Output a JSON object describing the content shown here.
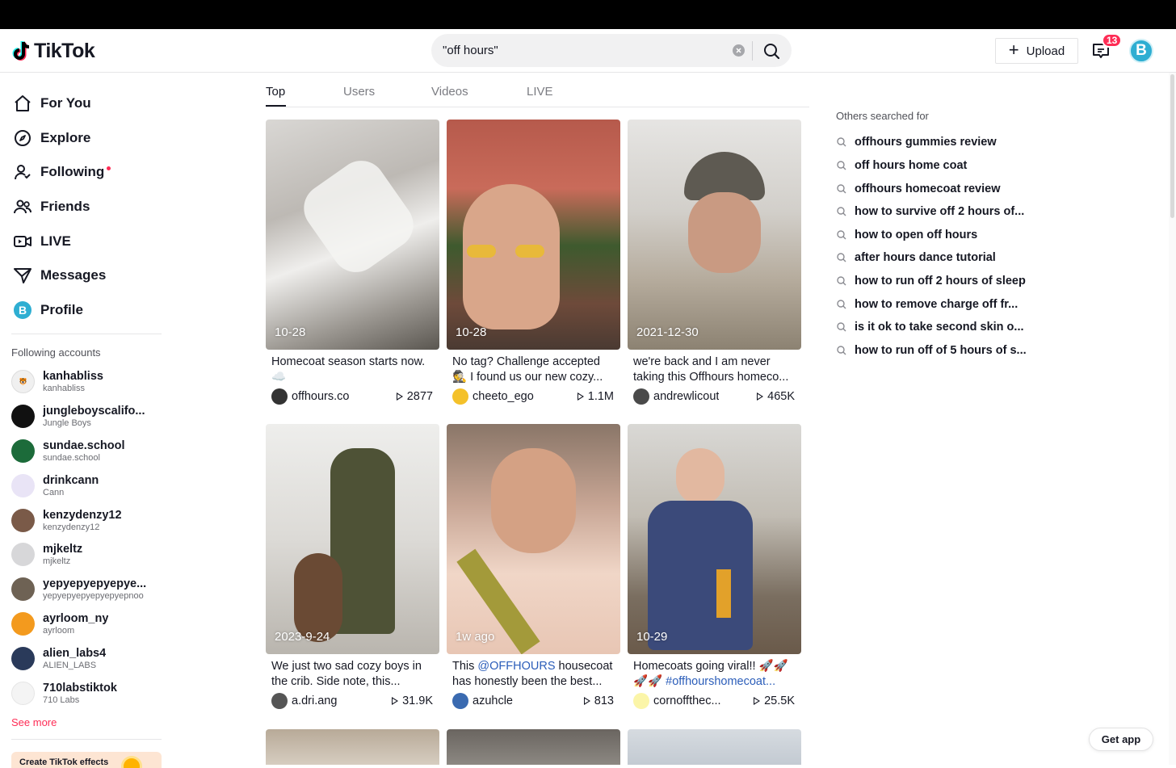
{
  "app": {
    "logo_text": "TikTok",
    "accent": "#fe2c55"
  },
  "search": {
    "value": "\"off hours\""
  },
  "header": {
    "upload_label": "Upload",
    "notification_count": "13",
    "avatar_letter": "B"
  },
  "nav": [
    {
      "label": "For You",
      "icon": "home-icon"
    },
    {
      "label": "Explore",
      "icon": "compass-icon"
    },
    {
      "label": "Following",
      "icon": "following-icon"
    },
    {
      "label": "Friends",
      "icon": "friends-icon"
    },
    {
      "label": "LIVE",
      "icon": "live-icon"
    },
    {
      "label": "Messages",
      "icon": "messages-icon"
    },
    {
      "label": "Profile",
      "icon": "profile-icon"
    }
  ],
  "following": {
    "title": "Following accounts",
    "accounts": [
      {
        "name": "kanhabliss",
        "sub": "kanhabliss"
      },
      {
        "name": "jungleboyscalifo...",
        "sub": "Jungle Boys"
      },
      {
        "name": "sundae.school",
        "sub": "sundae.school"
      },
      {
        "name": "drinkcann",
        "sub": "Cann"
      },
      {
        "name": "kenzydenzy12",
        "sub": "kenzydenzy12"
      },
      {
        "name": "mjkeltz",
        "sub": "mjkeltz"
      },
      {
        "name": "yepyepyepyepye...",
        "sub": "yepyepyepyepyepyepnoo"
      },
      {
        "name": "ayrloom_ny",
        "sub": "ayrloom"
      },
      {
        "name": "alien_labs4",
        "sub": "ALIEN_LABS"
      },
      {
        "name": "710labstiktok",
        "sub": "710 Labs"
      }
    ],
    "see_more": "See more",
    "effects_banner": "Create TikTok effects"
  },
  "tabs": [
    "Top",
    "Users",
    "Videos",
    "LIVE"
  ],
  "videos": [
    {
      "date": "10-28",
      "desc_line1": "Homecoat season starts now.",
      "desc_line2": "☁️",
      "user": "offhours.co",
      "views": "2877"
    },
    {
      "date": "10-28",
      "desc_line1": "No tag? Challenge accepted",
      "desc_line2": "🕵️ I found us our new cozy...",
      "user": "cheeto_ego",
      "views": "1.1M"
    },
    {
      "date": "2021-12-30",
      "desc_line1": "we're back and I am never",
      "desc_line2": "taking this Offhours homeco...",
      "user": "andrewlicout",
      "views": "465K"
    },
    {
      "date": "2023-9-24",
      "desc_line1": "We just two sad cozy boys in",
      "desc_line2": "the crib. Side note, this...",
      "user": "a.dri.ang",
      "views": "31.9K"
    },
    {
      "date": "1w ago",
      "desc_pre": "This ",
      "desc_tag": "@OFFHOURS",
      "desc_post": " housecoat",
      "desc_line2": "has honestly been the best...",
      "user": "azuhcle",
      "views": "813"
    },
    {
      "date": "10-29",
      "desc_line1": "Homecoats going viral!! 🚀🚀",
      "desc_line2_pre": "🚀🚀 ",
      "desc_line2_tag": "#offhourshomecoat...",
      "user": "cornoffthec...",
      "views": "25.5K"
    }
  ],
  "others": {
    "title": "Others searched for",
    "items": [
      "offhours gummies review",
      "off hours home coat",
      "offhours homecoat review",
      "how to survive off 2 hours of...",
      "how to open off hours",
      "after hours dance tutorial",
      "how to run off 2 hours of sleep",
      "how to remove charge off fr...",
      "is it ok to take second skin o...",
      "how to run off of 5 hours of s..."
    ]
  },
  "get_app": "Get app"
}
